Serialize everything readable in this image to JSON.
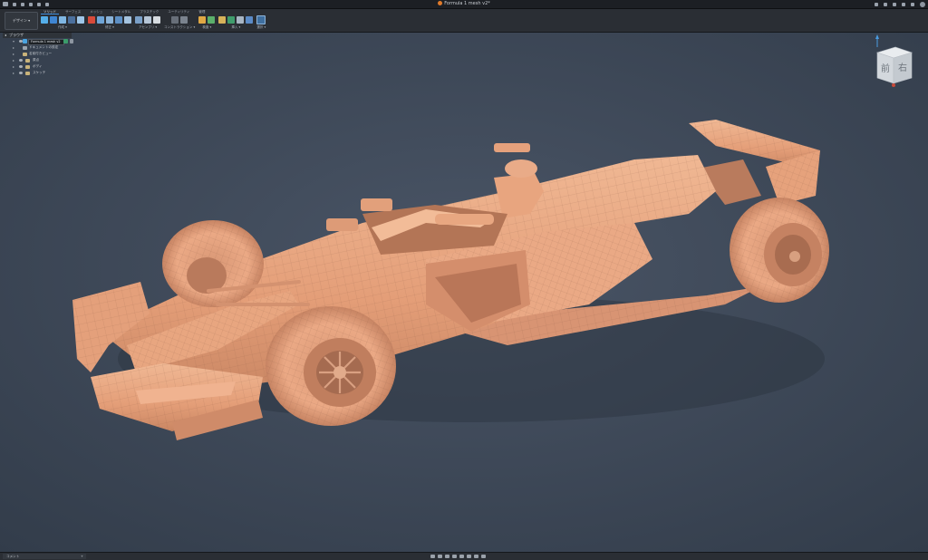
{
  "window": {
    "title": "Formula 1 mesh v2*"
  },
  "workspace": {
    "label": "デザイン ▾"
  },
  "ribbon": {
    "tabs": [
      "ソリッド",
      "サーフェス",
      "メッシュ",
      "シートメタル",
      "プラスチック",
      "ユーティリティ",
      "管理"
    ],
    "groups": [
      {
        "label": "作成 ▾"
      },
      {
        "label": "修正 ▾"
      },
      {
        "label": "アセンブリ ▾"
      },
      {
        "label": "コンストラクション ▾"
      },
      {
        "label": "検査 ▾"
      },
      {
        "label": "挿入 ▾"
      },
      {
        "label": "選択 ▾"
      }
    ]
  },
  "browser": {
    "header": "ブラウザ",
    "document": "Formula 1 mesh v2",
    "items": [
      {
        "label": "ドキュメントの設定"
      },
      {
        "label": "名前付きビュー"
      },
      {
        "label": "原点"
      },
      {
        "label": "ボディ"
      },
      {
        "label": "スケッチ"
      }
    ]
  },
  "viewcube": {
    "front": "前",
    "right": "右"
  },
  "bottom": {
    "comments": "コメント"
  },
  "colors": {
    "background": "#3c4756",
    "model": "#e7a77f",
    "accent": "#3f8fe0"
  }
}
